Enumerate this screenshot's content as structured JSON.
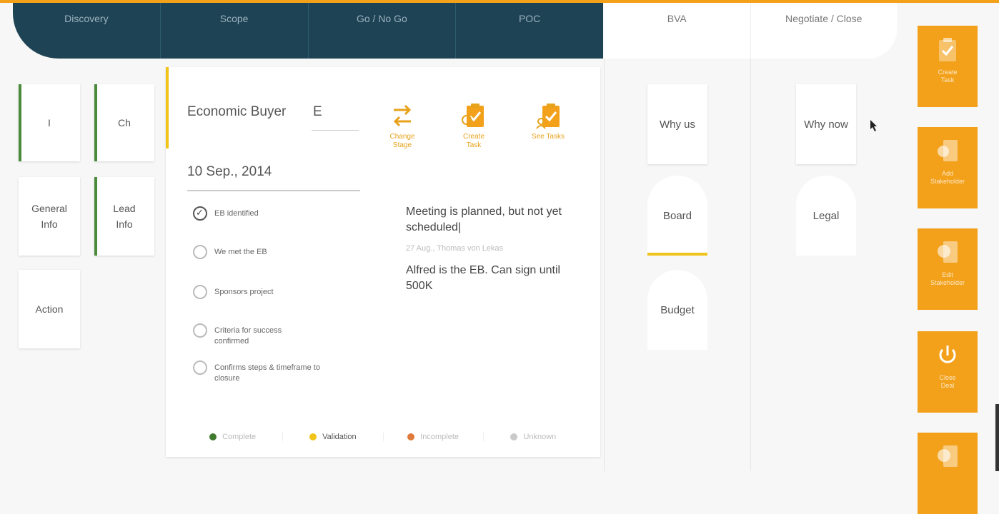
{
  "stages_dark": [
    "Discovery",
    "Scope",
    "Go / No Go",
    "POC"
  ],
  "stages_light": [
    "BVA",
    "Negotiate / Close"
  ],
  "left_cards": {
    "i": "I",
    "ch": "Ch",
    "general_info": "General\nInfo",
    "lead_info": "Lead\nInfo",
    "action": "Action"
  },
  "panel": {
    "title": "Economic Buyer",
    "abbr": "E",
    "date": "10 Sep., 2014",
    "actions": [
      {
        "label": "Change\nStage",
        "icon": "swap-arrows-icon"
      },
      {
        "label": "Create\nTask",
        "icon": "clipboard-check-icon"
      },
      {
        "label": "See Tasks",
        "icon": "clipboard-person-icon"
      }
    ],
    "checklist": [
      {
        "label": "EB identified",
        "checked": true
      },
      {
        "label": "We met the EB",
        "checked": false
      },
      {
        "label": "Sponsors project",
        "checked": false
      },
      {
        "label": "Criteria for success confirmed",
        "checked": false
      },
      {
        "label": "Confirms steps & timeframe to closure",
        "checked": false
      }
    ],
    "note_main": "Meeting is planned, but not yet scheduled|",
    "note_meta": "27 Aug., Thomas von Lekas",
    "note_second": "Alfred is the EB. Can sign until 500K",
    "legend": [
      {
        "label": "Complete",
        "color": "#3f7a2e"
      },
      {
        "label": "Validation",
        "color": "#f0c419"
      },
      {
        "label": "Incomplete",
        "color": "#e07a3a"
      },
      {
        "label": "Unknown",
        "color": "#c9c9c9"
      }
    ]
  },
  "bva_tiles": [
    "Why us",
    "Board",
    "Budget"
  ],
  "negotiate_tiles": [
    "Why now",
    "Legal"
  ],
  "orange_tiles": [
    {
      "label": "Create\nTask",
      "icon": "clipboard-check-icon"
    },
    {
      "label": "Add\nStakeholder",
      "icon": "person-add-icon"
    },
    {
      "label": "Edit\nStakeholder",
      "icon": "person-edit-icon"
    },
    {
      "label": "Close\nDeal",
      "icon": "power-icon"
    },
    {
      "label": "",
      "icon": "document-icon"
    }
  ]
}
